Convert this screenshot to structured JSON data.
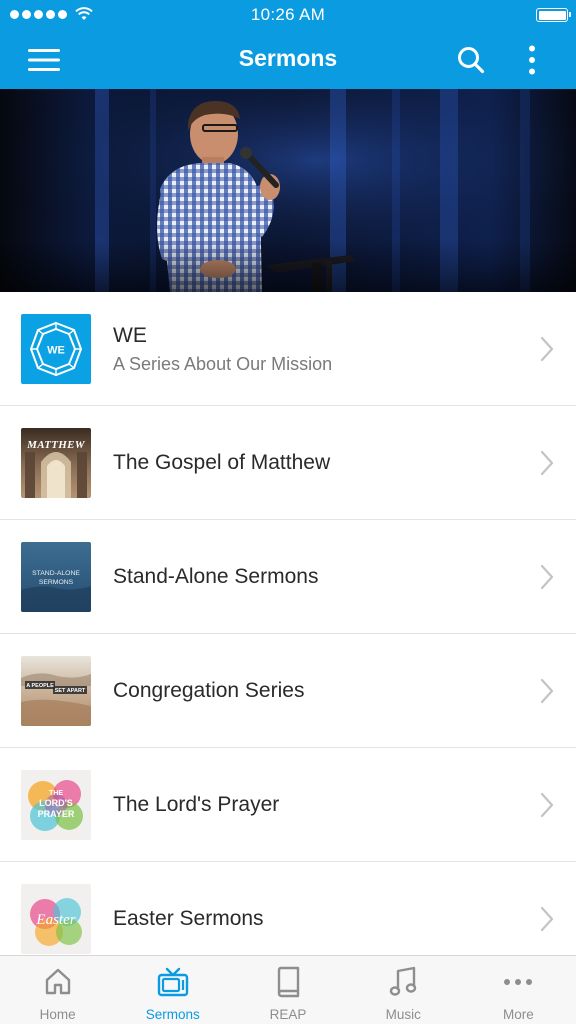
{
  "status_bar": {
    "time": "10:26 AM"
  },
  "nav": {
    "title": "Sermons",
    "icons": [
      "hamburger-menu-icon",
      "search-icon",
      "vertical-ellipsis-icon"
    ]
  },
  "colors": {
    "brand_blue": "#0a9be0",
    "tab_inactive": "#8e8e8e",
    "text_primary": "#2a2a2a",
    "text_secondary": "#7a7a7a"
  },
  "series": [
    {
      "title": "WE",
      "subtitle": "A Series About Our Mission",
      "thumb_text": "WE"
    },
    {
      "title": "The Gospel of Matthew",
      "thumb_text": "MATTHEW"
    },
    {
      "title": "Stand-Alone Sermons",
      "thumb_text_line1": "STAND-ALONE",
      "thumb_text_line2": "SERMONS"
    },
    {
      "title": "Congregation Series",
      "thumb_text_line1": "A PEOPLE",
      "thumb_text_line2": "SET APART"
    },
    {
      "title": "The Lord's Prayer",
      "thumb_text_line1": "THE",
      "thumb_text_line2": "LORD'S",
      "thumb_text_line3": "PRAYER"
    },
    {
      "title": "Easter Sermons",
      "thumb_text": "Easter"
    }
  ],
  "tabs": [
    {
      "label": "Home",
      "icon": "home-icon",
      "active": false
    },
    {
      "label": "Sermons",
      "icon": "tv-icon",
      "active": true
    },
    {
      "label": "REAP",
      "icon": "book-icon",
      "active": false
    },
    {
      "label": "Music",
      "icon": "music-note-icon",
      "active": false
    },
    {
      "label": "More",
      "icon": "horizontal-ellipsis-icon",
      "active": false
    }
  ]
}
